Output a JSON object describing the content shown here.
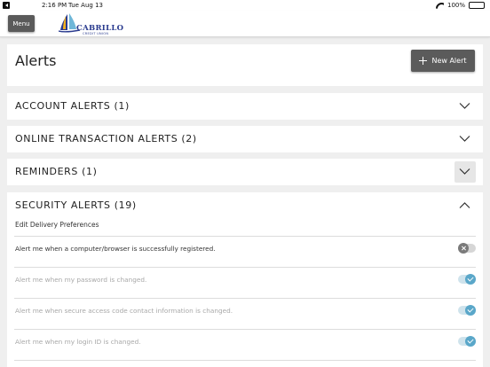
{
  "status_bar": {
    "time": "2:16 PM",
    "date": "Tue Aug 13",
    "battery": "100%"
  },
  "nav": {
    "menu_label": "Menu",
    "logo_name": "CABRILLO",
    "logo_sub": "CREDIT UNION"
  },
  "header": {
    "title": "Alerts",
    "new_alert_label": "New Alert"
  },
  "sections": {
    "account": {
      "label": "ACCOUNT ALERTS (1)",
      "expanded": false
    },
    "online": {
      "label": "ONLINE TRANSACTION ALERTS (2)",
      "expanded": false
    },
    "reminders": {
      "label": "REMINDERS (1)",
      "expanded": false
    },
    "security": {
      "label": "SECURITY ALERTS (19)",
      "expanded": true,
      "edit_delivery": "Edit Delivery Preferences",
      "rows": [
        {
          "text": "Alert me when a computer/browser is successfully registered.",
          "enabled": false
        },
        {
          "text": "Alert me when my password is changed.",
          "enabled": true
        },
        {
          "text": "Alert me when secure access code contact information is changed.",
          "enabled": true
        },
        {
          "text": "Alert me when my login ID is changed.",
          "enabled": true
        }
      ]
    }
  },
  "colors": {
    "button_dark": "#5b5b5b",
    "toggle_on": "#5aa7c9",
    "brand_blue": "#2a3b8f"
  }
}
